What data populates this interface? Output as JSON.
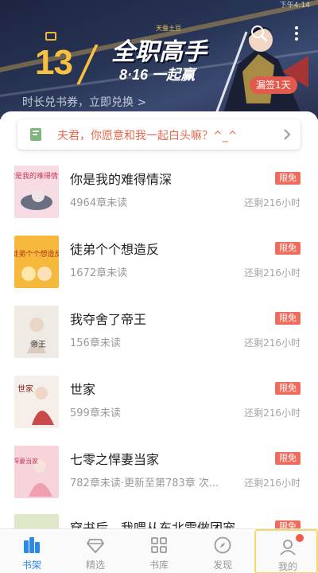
{
  "status_bar": {
    "time": "下午4:14"
  },
  "banner": {
    "top_label": "天蚕土豆",
    "number": "13",
    "title": "全职高手",
    "date_text": "8·16 一起赢",
    "redeem_text": "时长兑书券，立即兑换 >",
    "signin_badge": "漏签1天",
    "accent_color": "#f8c041"
  },
  "notice": {
    "text": "夫君，你愿意和我一起白头嘛？^_^",
    "icon": "book-icon"
  },
  "books": [
    {
      "title": "你是我的难得情深",
      "progress": "4964章未读",
      "badge": "限免",
      "remaining": "还剩216小时",
      "cover_color": "#f6d5dc",
      "cover_text": "你是我的难得情深"
    },
    {
      "title": "徒弟个个想造反",
      "progress": "1672章未读",
      "badge": "限免",
      "remaining": "还剩216小时",
      "cover_color": "#f6b93b",
      "cover_text": "徒弟个个想造反"
    },
    {
      "title": "我夺舍了帝王",
      "progress": "156章未读",
      "badge": "限免",
      "remaining": "还剩216小时",
      "cover_color": "#ece7e0",
      "cover_text": "帝王"
    },
    {
      "title": "世家",
      "progress": "599章未读",
      "badge": "限免",
      "remaining": "还剩216小时",
      "cover_color": "#f4ece6",
      "cover_text": "世家"
    },
    {
      "title": "七零之悍妻当家",
      "progress": "782章未读·更新至第783章 次...",
      "badge": "限免",
      "remaining": "还剩216小时",
      "cover_color": "#f7d1d8",
      "cover_text": "悍妻当家"
    },
    {
      "title": "穿书后，我喂从东北雪做团宠",
      "progress": "",
      "badge": "限免",
      "remaining": "",
      "cover_color": "#dfe7c9",
      "cover_text": ""
    }
  ],
  "bottom_nav": [
    {
      "label": "书架",
      "icon": "bookshelf-icon",
      "active": true
    },
    {
      "label": "精选",
      "icon": "diamond-icon",
      "active": false
    },
    {
      "label": "书库",
      "icon": "grid-icon",
      "active": false
    },
    {
      "label": "发现",
      "icon": "compass-icon",
      "active": false
    },
    {
      "label": "我的",
      "icon": "profile-icon",
      "active": false
    }
  ]
}
